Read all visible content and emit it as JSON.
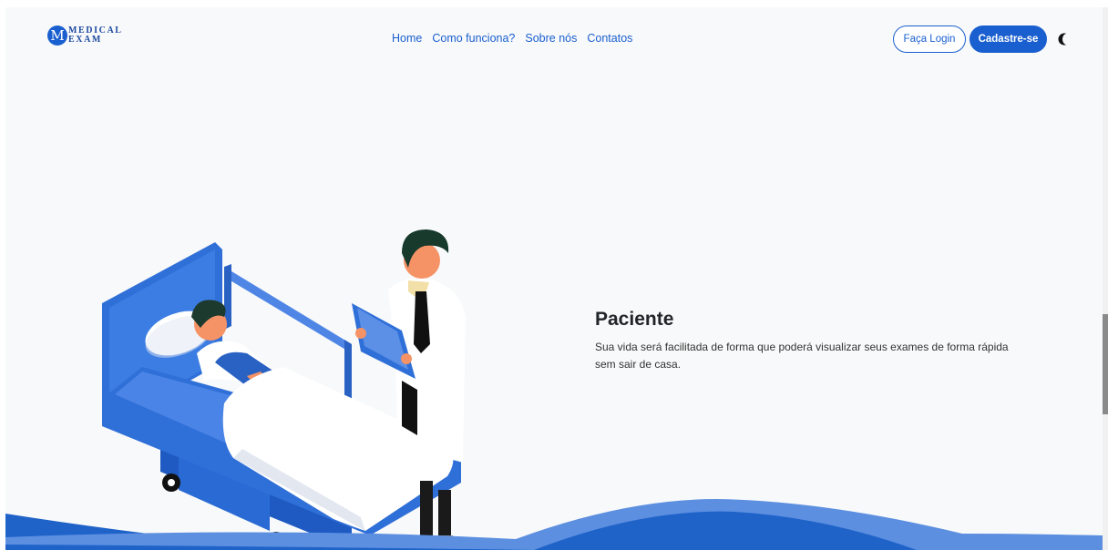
{
  "header": {
    "logo": {
      "mark": "M",
      "line1": "MEDICAL",
      "line2": "EXAM"
    },
    "nav": [
      "Home",
      "Como funciona?",
      "Sobre nós",
      "Contatos"
    ],
    "login_label": "Faça Login",
    "signup_label": "Cadastre-se",
    "theme_icon": "moon-icon"
  },
  "hero": {
    "title": "Paciente",
    "text": "Sua vida será facilitada de forma que poderá visualizar seus exames de forma rápida sem sair de casa."
  },
  "colors": {
    "primary": "#1a5fcf",
    "background": "#f8f9fa",
    "wave_dark": "#1f63c9",
    "wave_light": "#5c8fe0"
  }
}
